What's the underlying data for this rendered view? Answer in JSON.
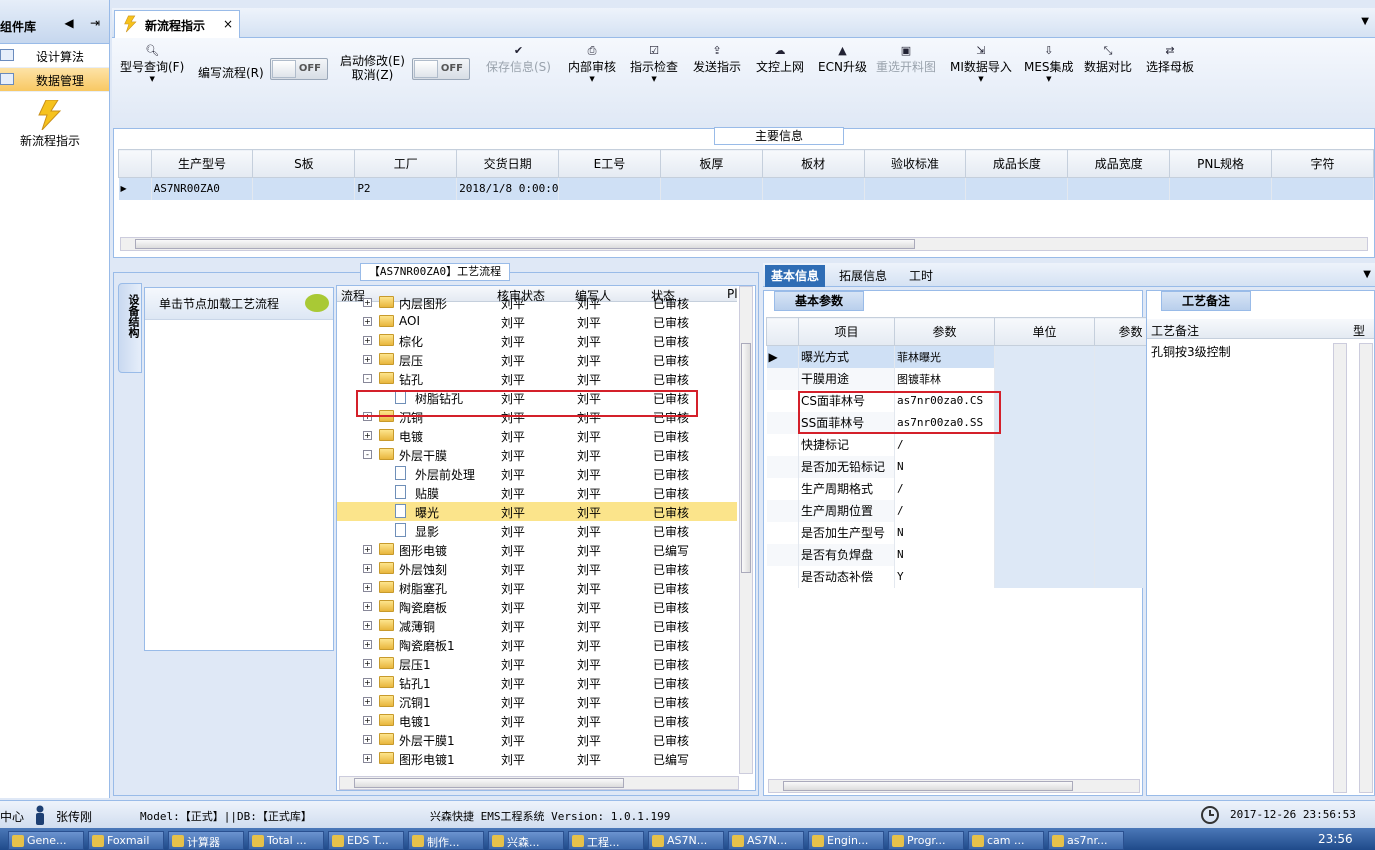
{
  "left_panel": {
    "title": "组件库",
    "items": [
      {
        "label": "设计算法"
      },
      {
        "label": "数据管理"
      }
    ],
    "new_flow_label": "新流程指示"
  },
  "tab": {
    "title": "新流程指示",
    "close": "×"
  },
  "toolbar": {
    "query": "型号查询(F)",
    "write": "编写流程(R)",
    "toggle1": "OFF",
    "modify": "启动修改(E)",
    "cancel": "取消(Z)",
    "toggle2": "OFF",
    "save": "保存信息(S)",
    "audit": "内部审核",
    "check": "指示检查",
    "send": "发送指示",
    "upload": "文控上网",
    "ecn": "ECN升级",
    "reselect": "重选开料图",
    "mi": "MI数据导入",
    "mes": "MES集成",
    "compare": "数据对比",
    "select": "选择母板"
  },
  "main_info": {
    "label": "主要信息",
    "columns": [
      "生产型号",
      "S板",
      "工厂",
      "交货日期",
      "E工号",
      "板厚",
      "板材",
      "验收标准",
      "成品长度",
      "成品宽度",
      "PNL规格",
      "字符"
    ],
    "row": [
      "AS7NR00ZA0",
      "",
      "P2",
      "2018/1/8 0:00:00",
      "",
      "",
      "",
      "",
      "",
      "",
      "",
      ""
    ]
  },
  "flow": {
    "title": "【AS7NR00ZA0】工艺流程",
    "side_tab": "设备结构",
    "hint": "单击节点加载工艺流程",
    "columns": [
      "流程",
      "核审状态",
      "编写人",
      "状态",
      "Pl"
    ],
    "rows": [
      {
        "name": "内层图形",
        "level": 0,
        "type": "folder",
        "exp": "+",
        "a": "刘平",
        "b": "刘平",
        "c": "已审核"
      },
      {
        "name": "AOI",
        "level": 0,
        "type": "folder",
        "exp": "+",
        "a": "刘平",
        "b": "刘平",
        "c": "已审核"
      },
      {
        "name": "棕化",
        "level": 0,
        "type": "folder",
        "exp": "+",
        "a": "刘平",
        "b": "刘平",
        "c": "已审核"
      },
      {
        "name": "层压",
        "level": 0,
        "type": "folder",
        "exp": "+",
        "a": "刘平",
        "b": "刘平",
        "c": "已审核"
      },
      {
        "name": "钻孔",
        "level": 0,
        "type": "folder",
        "exp": "-",
        "a": "刘平",
        "b": "刘平",
        "c": "已审核"
      },
      {
        "name": "树脂钻孔",
        "level": 1,
        "type": "doc",
        "exp": "",
        "a": "刘平",
        "b": "刘平",
        "c": "已审核"
      },
      {
        "name": "沉铜",
        "level": 0,
        "type": "folder",
        "exp": "+",
        "a": "刘平",
        "b": "刘平",
        "c": "已审核"
      },
      {
        "name": "电镀",
        "level": 0,
        "type": "folder",
        "exp": "+",
        "a": "刘平",
        "b": "刘平",
        "c": "已审核"
      },
      {
        "name": "外层干膜",
        "level": 0,
        "type": "folder",
        "exp": "-",
        "a": "刘平",
        "b": "刘平",
        "c": "已审核"
      },
      {
        "name": "外层前处理",
        "level": 1,
        "type": "doc",
        "exp": "",
        "a": "刘平",
        "b": "刘平",
        "c": "已审核"
      },
      {
        "name": "贴膜",
        "level": 1,
        "type": "doc",
        "exp": "",
        "a": "刘平",
        "b": "刘平",
        "c": "已审核"
      },
      {
        "name": "曝光",
        "level": 1,
        "type": "doc",
        "exp": "",
        "a": "刘平",
        "b": "刘平",
        "c": "已审核",
        "sel": true
      },
      {
        "name": "显影",
        "level": 1,
        "type": "doc",
        "exp": "",
        "a": "刘平",
        "b": "刘平",
        "c": "已审核"
      },
      {
        "name": "图形电镀",
        "level": 0,
        "type": "folder",
        "exp": "+",
        "a": "刘平",
        "b": "刘平",
        "c": "已编写"
      },
      {
        "name": "外层蚀刻",
        "level": 0,
        "type": "folder",
        "exp": "+",
        "a": "刘平",
        "b": "刘平",
        "c": "已审核"
      },
      {
        "name": "树脂塞孔",
        "level": 0,
        "type": "folder",
        "exp": "+",
        "a": "刘平",
        "b": "刘平",
        "c": "已审核"
      },
      {
        "name": "陶瓷磨板",
        "level": 0,
        "type": "folder",
        "exp": "+",
        "a": "刘平",
        "b": "刘平",
        "c": "已审核"
      },
      {
        "name": "减薄铜",
        "level": 0,
        "type": "folder",
        "exp": "+",
        "a": "刘平",
        "b": "刘平",
        "c": "已审核"
      },
      {
        "name": "陶瓷磨板1",
        "level": 0,
        "type": "folder",
        "exp": "+",
        "a": "刘平",
        "b": "刘平",
        "c": "已审核"
      },
      {
        "name": "层压1",
        "level": 0,
        "type": "folder",
        "exp": "+",
        "a": "刘平",
        "b": "刘平",
        "c": "已审核"
      },
      {
        "name": "钻孔1",
        "level": 0,
        "type": "folder",
        "exp": "+",
        "a": "刘平",
        "b": "刘平",
        "c": "已审核"
      },
      {
        "name": "沉铜1",
        "level": 0,
        "type": "folder",
        "exp": "+",
        "a": "刘平",
        "b": "刘平",
        "c": "已审核"
      },
      {
        "name": "电镀1",
        "level": 0,
        "type": "folder",
        "exp": "+",
        "a": "刘平",
        "b": "刘平",
        "c": "已审核"
      },
      {
        "name": "外层干膜1",
        "level": 0,
        "type": "folder",
        "exp": "+",
        "a": "刘平",
        "b": "刘平",
        "c": "已审核"
      },
      {
        "name": "图形电镀1",
        "level": 0,
        "type": "folder",
        "exp": "+",
        "a": "刘平",
        "b": "刘平",
        "c": "已编写"
      }
    ]
  },
  "right_tabs": [
    "基本信息",
    "拓展信息",
    "工时"
  ],
  "basic": {
    "label": "基本参数",
    "columns": [
      "项目",
      "参数",
      "单位",
      "参数"
    ],
    "rows": [
      [
        "曝光方式",
        "菲林曝光"
      ],
      [
        "干膜用途",
        "图镀菲林"
      ],
      [
        "CS面菲林号",
        "as7nr00za0.CS"
      ],
      [
        "SS面菲林号",
        "as7nr00za0.SS"
      ],
      [
        "快捷标记",
        "/"
      ],
      [
        "是否加无铅标记",
        "N"
      ],
      [
        "生产周期格式",
        "/"
      ],
      [
        "生产周期位置",
        "/"
      ],
      [
        "是否加生产型号",
        "N"
      ],
      [
        "是否有负焊盘",
        "N"
      ],
      [
        "是否动态补偿",
        "Y"
      ]
    ]
  },
  "remark": {
    "label": "工艺备注",
    "col1": "工艺备注",
    "col2": "型",
    "text": "孔铜按3级控制"
  },
  "status": {
    "center": "中心",
    "user": "张传刚",
    "model": "Model:【正式】||DB:【正式库】",
    "system": "兴森快捷 EMS工程系统 Version: 1.0.1.199",
    "datetime": "2017-12-26 23:56:53"
  },
  "taskbar": {
    "items": [
      "Gene...",
      "Foxmail",
      "计算器",
      "Total ...",
      "EDS T...",
      "制作...",
      "兴森...",
      "工程...",
      "AS7N...",
      "AS7N...",
      "Engin...",
      "Progr...",
      "cam ...",
      "as7nr..."
    ],
    "clock": "23:56"
  }
}
